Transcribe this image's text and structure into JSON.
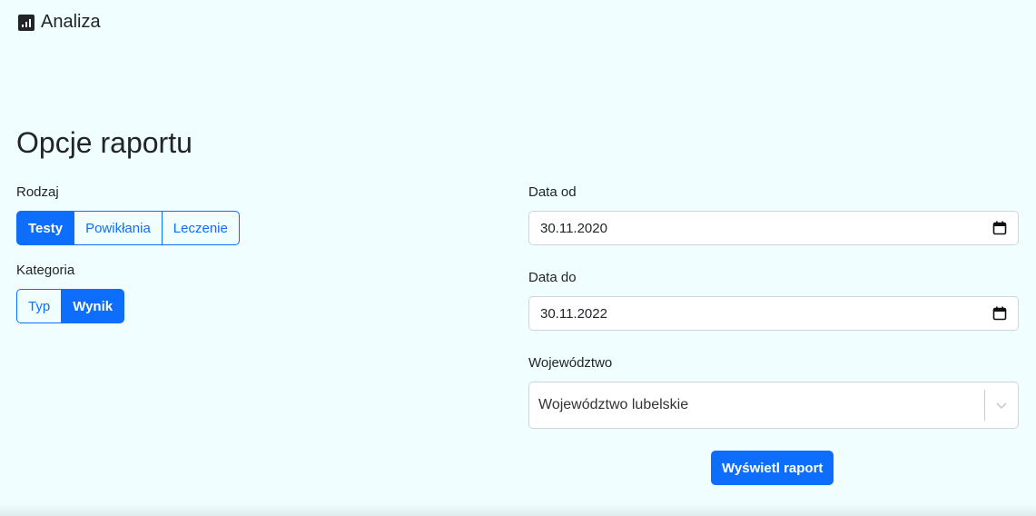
{
  "header": {
    "app_icon": "bar-chart-icon",
    "title": "Analiza"
  },
  "page_title": "Opcje raportu",
  "rodzaj": {
    "label": "Rodzaj",
    "options": [
      "Testy",
      "Powikłania",
      "Leczenie"
    ],
    "selected": "Testy"
  },
  "kategoria": {
    "label": "Kategoria",
    "options": [
      "Typ",
      "Wynik"
    ],
    "selected": "Wynik"
  },
  "data_od": {
    "label": "Data od",
    "value": "30.11.2020",
    "icon": "calendar-icon"
  },
  "data_do": {
    "label": "Data do",
    "value": "30.11.2022",
    "icon": "calendar-icon"
  },
  "wojewodztwo": {
    "label": "Województwo",
    "value": "Województwo lubelskie",
    "icon": "chevron-down-icon"
  },
  "submit_label": "Wyświetl raport",
  "colors": {
    "background": "#f0feff",
    "accent": "#0d6efd"
  }
}
